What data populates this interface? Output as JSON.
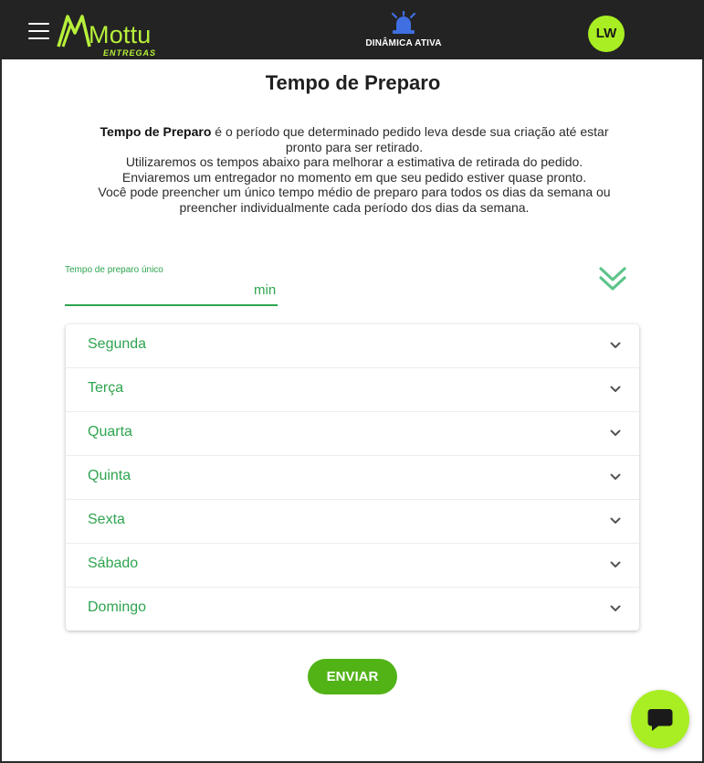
{
  "header": {
    "logo_text": "Mottu",
    "logo_subtext": "ENTREGAS",
    "dynamic_label": "DINÂMICA ATIVA",
    "avatar_initials": "LW"
  },
  "page": {
    "title": "Tempo de Preparo",
    "description": {
      "bold": "Tempo de Preparo",
      "line1_rest": " é o período que determinado pedido leva desde sua criação até estar pronto para ser retirado.",
      "line2": "Utilizaremos os tempos abaixo para melhorar a estimativa de retirada do pedido.",
      "line3": "Enviaremos um entregador no momento em que seu pedido estiver quase pronto.",
      "line4": "Você pode preencher um único tempo médio de preparo para todos os dias da semana ou preencher individualmente cada período dos dias da semana."
    }
  },
  "single_time": {
    "label": "Tempo de preparo único",
    "value": "",
    "unit": "min"
  },
  "days": [
    {
      "label": "Segunda"
    },
    {
      "label": "Terça"
    },
    {
      "label": "Quarta"
    },
    {
      "label": "Quinta"
    },
    {
      "label": "Sexta"
    },
    {
      "label": "Sábado"
    },
    {
      "label": "Domingo"
    }
  ],
  "actions": {
    "submit_label": "ENVIAR"
  },
  "colors": {
    "brand_lime": "#a8ee22",
    "accent_green": "#2ea44f",
    "button_green": "#52b317",
    "siren_blue": "#3f6fe0",
    "topbar": "#232323"
  },
  "icons": {
    "menu": "hamburger-icon",
    "dynamic": "siren-icon",
    "expand_all": "double-chevron-down-icon",
    "day_toggle": "chevron-down-icon",
    "chat": "chat-bubble-icon"
  }
}
